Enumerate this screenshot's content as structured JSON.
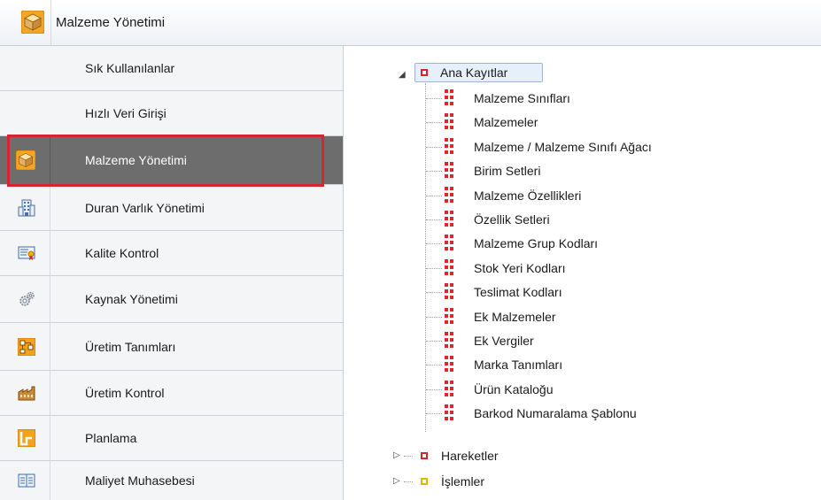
{
  "header": {
    "title": "Malzeme Yönetimi",
    "icon": "package-box-icon"
  },
  "nav": {
    "items": [
      {
        "label": "Sık Kullanılanlar",
        "icon": null,
        "active": false
      },
      {
        "label": "Hızlı Veri Girişi",
        "icon": null,
        "active": false
      },
      {
        "label": "Malzeme Yönetimi",
        "icon": "package-box-icon",
        "active": true
      },
      {
        "label": "Duran Varlık Yönetimi",
        "icon": "building-icon",
        "active": false
      },
      {
        "label": "Kalite Kontrol",
        "icon": "certificate-icon",
        "active": false
      },
      {
        "label": "Kaynak Yönetimi",
        "icon": "gears-icon",
        "active": false
      },
      {
        "label": "Üretim Tanımları",
        "icon": "flowchart-icon",
        "active": false
      },
      {
        "label": "Üretim Kontrol",
        "icon": "factory-icon",
        "active": false
      },
      {
        "label": "Planlama",
        "icon": "planning-icon",
        "active": false
      },
      {
        "label": "Maliyet Muhasebesi",
        "icon": "ledger-icon",
        "active": false
      }
    ]
  },
  "tree": {
    "root": {
      "label": "Ana Kayıtlar",
      "expanded": true
    },
    "children": [
      "Malzeme Sınıfları",
      "Malzemeler",
      "Malzeme / Malzeme Sınıfı Ağacı",
      "Birim Setleri",
      "Malzeme Özellikleri",
      "Özellik Setleri",
      "Malzeme Grup Kodları",
      "Stok Yeri Kodları",
      "Teslimat Kodları",
      "Ek Malzemeler",
      "Ek Vergiler",
      "Marka Tanımları",
      "Ürün Kataloğu",
      "Barkod Numaralama Şablonu"
    ],
    "siblings": [
      {
        "label": "Hareketler",
        "expanded": false,
        "color": "#d9242b"
      },
      {
        "label": "İşlemler",
        "expanded": false,
        "color": "#e6b400"
      }
    ]
  },
  "colors": {
    "active_bg": "#6d6d6d",
    "highlight_border": "#d9242b",
    "node_red": "#e0262d"
  }
}
